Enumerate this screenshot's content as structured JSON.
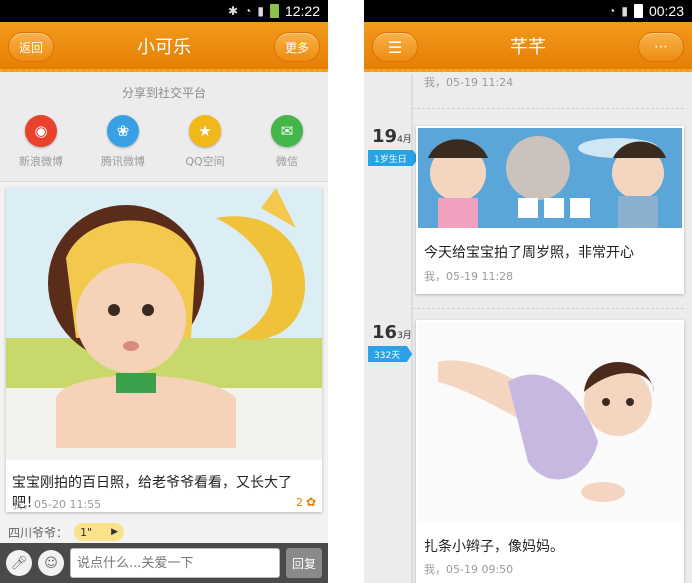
{
  "left": {
    "status": {
      "time": "12:22"
    },
    "topbar": {
      "title": "小可乐",
      "back": "返回",
      "more": "更多"
    },
    "share": {
      "title": "分享到社交平台",
      "items": [
        {
          "label": "新浪微博",
          "color": "#e8412c"
        },
        {
          "label": "腾讯微博",
          "color": "#3aa0e6"
        },
        {
          "label": "QQ空间",
          "color": "#f2b81a"
        },
        {
          "label": "微信",
          "color": "#44b549"
        }
      ]
    },
    "post": {
      "caption": "宝宝刚拍的百日照，给老爷爷看看，又长大了吧！",
      "meta": "我，05-20 11:55",
      "count": "2"
    },
    "comment": {
      "author": "四川爷爷：",
      "voice": "1\""
    },
    "input": {
      "placeholder": "说点什么...关爱一下",
      "reply": "回复"
    }
  },
  "right": {
    "status": {
      "time": "00:23"
    },
    "topbar": {
      "title": "芊芊"
    },
    "prev_meta": "我，05-19 11:24",
    "entries": [
      {
        "day": "19",
        "month": "4月",
        "tag": "1岁生日",
        "caption": "今天给宝宝拍了周岁照，非常开心",
        "meta": "我，05-19 11:28"
      },
      {
        "day": "16",
        "month": "3月",
        "tag": "332天",
        "caption": "扎条小辫子，像妈妈。",
        "meta": "我，05-19 09:50"
      }
    ]
  }
}
